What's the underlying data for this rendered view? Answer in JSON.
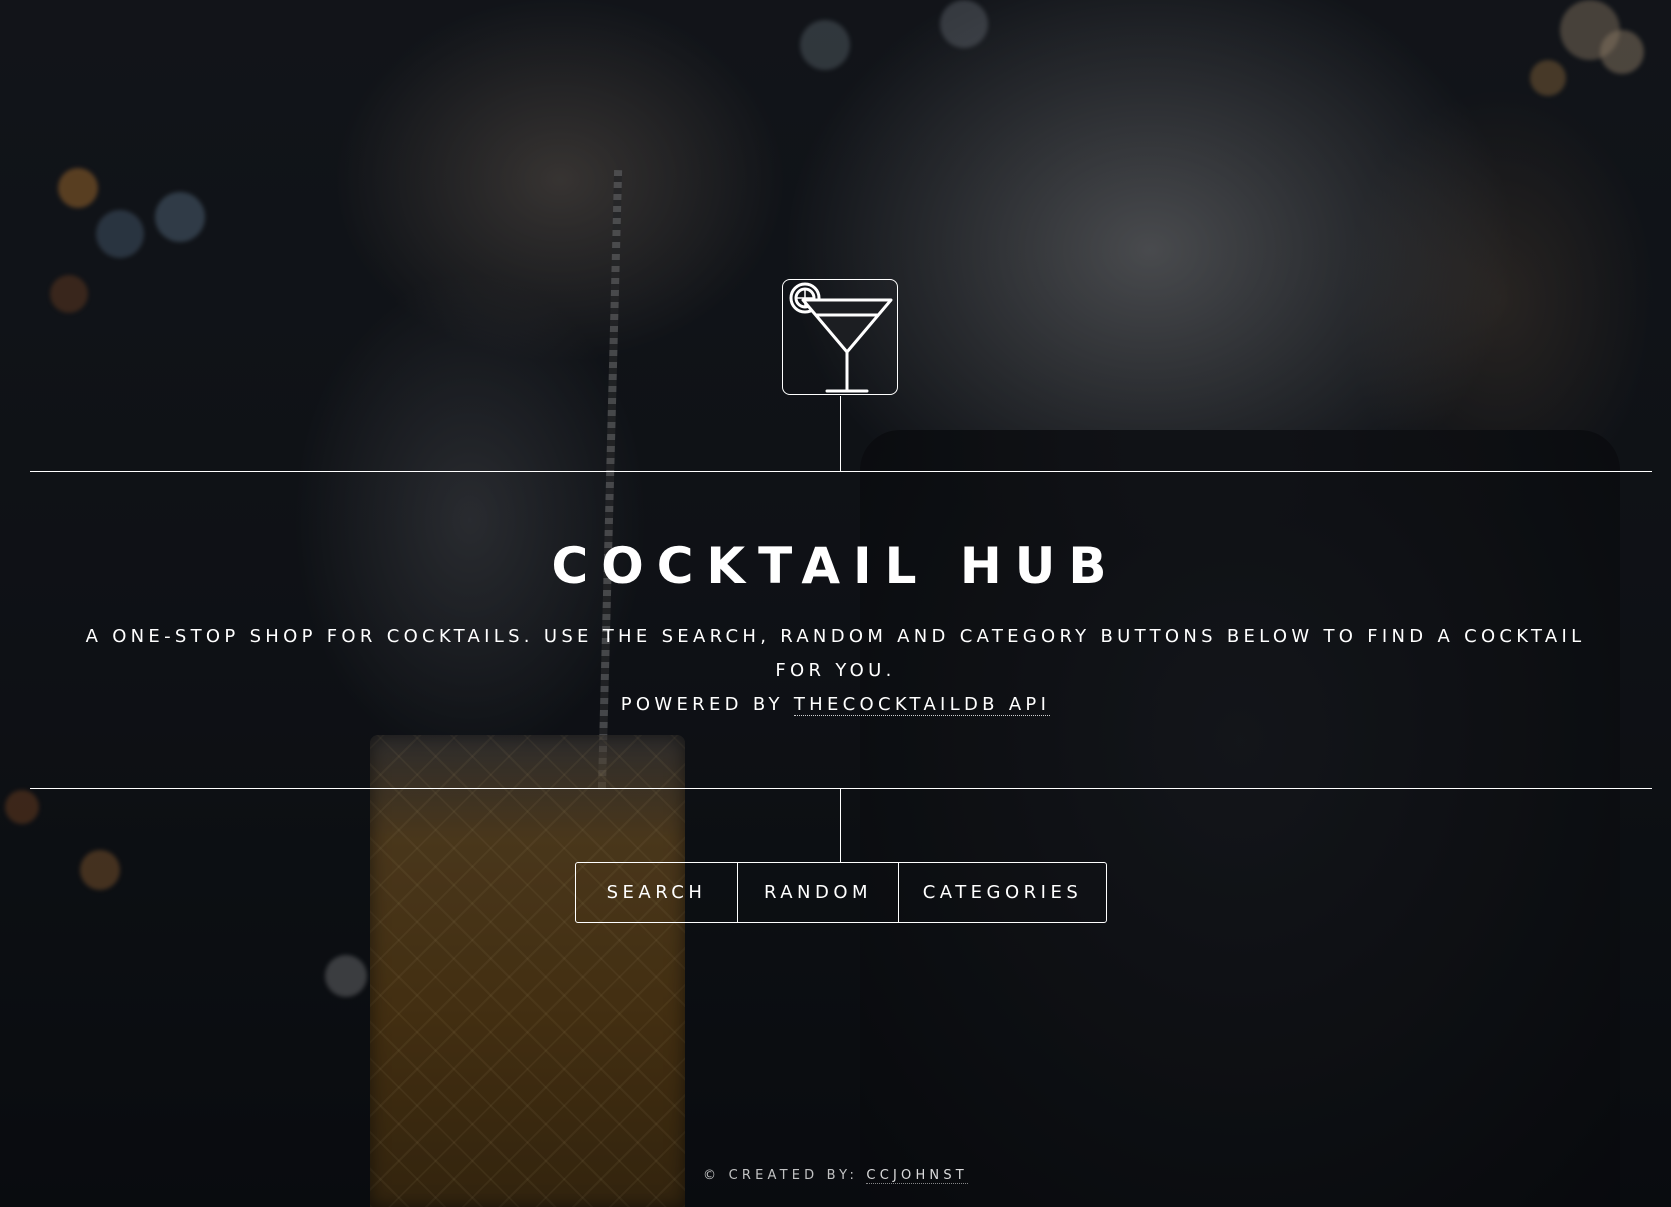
{
  "logo": {
    "icon": "cocktail-glass-icon"
  },
  "hero": {
    "title": "COCKTAIL HUB",
    "description": "A ONE-STOP SHOP FOR COCKTAILS. USE THE SEARCH, RANDOM AND CATEGORY BUTTONS BELOW TO FIND A COCKTAIL FOR YOU.",
    "powered_prefix": "POWERED BY ",
    "powered_link": "THECOCKTAILDB API"
  },
  "nav": {
    "search_label": "SEARCH",
    "random_label": "RANDOM",
    "categories_label": "CATEGORIES"
  },
  "footer": {
    "prefix": "© CREATED BY: ",
    "author_link": "CCJOHNST"
  },
  "colors": {
    "text": "#ffffff",
    "overlay": "#0d0f12"
  }
}
